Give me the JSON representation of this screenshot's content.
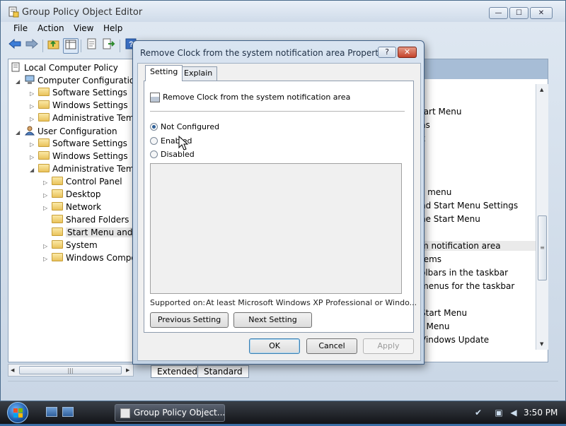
{
  "window": {
    "title": "Group Policy Object Editor",
    "controls": {
      "minimize": "—",
      "maximize": "☐",
      "close": "✕"
    }
  },
  "menu": [
    "File",
    "Action",
    "View",
    "Help"
  ],
  "toolbar": {
    "back": "back-arrow-icon",
    "forward": "forward-arrow-icon",
    "up": "up-folder-icon",
    "show_hide_tree": "show-hide-tree-icon",
    "properties": "properties-icon",
    "export": "export-list-icon",
    "help": "help-icon"
  },
  "tree": [
    {
      "label": "Local Computer Policy",
      "indent": 0,
      "arrow": "",
      "icon": "policy"
    },
    {
      "label": "Computer Configuration",
      "indent": 1,
      "arrow": "◢",
      "icon": "computer"
    },
    {
      "label": "Software Settings",
      "indent": 2,
      "arrow": "▷",
      "icon": "folder"
    },
    {
      "label": "Windows Settings",
      "indent": 2,
      "arrow": "▷",
      "icon": "folder"
    },
    {
      "label": "Administrative Temp",
      "indent": 2,
      "arrow": "▷",
      "icon": "folder"
    },
    {
      "label": "User Configuration",
      "indent": 1,
      "arrow": "◢",
      "icon": "user"
    },
    {
      "label": "Software Settings",
      "indent": 2,
      "arrow": "▷",
      "icon": "folder"
    },
    {
      "label": "Windows Settings",
      "indent": 2,
      "arrow": "▷",
      "icon": "folder"
    },
    {
      "label": "Administrative Temp",
      "indent": 2,
      "arrow": "◢",
      "icon": "folder"
    },
    {
      "label": "Control Panel",
      "indent": 3,
      "arrow": "▷",
      "icon": "folder"
    },
    {
      "label": "Desktop",
      "indent": 3,
      "arrow": "▷",
      "icon": "folder"
    },
    {
      "label": "Network",
      "indent": 3,
      "arrow": "▷",
      "icon": "folder"
    },
    {
      "label": "Shared Folders",
      "indent": 3,
      "arrow": "",
      "icon": "folder"
    },
    {
      "label": "Start Menu and T",
      "indent": 3,
      "arrow": "",
      "icon": "folder",
      "selected": true
    },
    {
      "label": "System",
      "indent": 3,
      "arrow": "▷",
      "icon": "folder"
    },
    {
      "label": "Windows Compo",
      "indent": 3,
      "arrow": "▷",
      "icon": "folder"
    }
  ],
  "right_items": [
    {
      "text": "tart Menu"
    },
    {
      "text": "ns"
    },
    {
      "text": "k"
    },
    {
      "text": ""
    },
    {
      "text": ""
    },
    {
      "text": "s menu"
    },
    {
      "text": "nd Start Menu Settings"
    },
    {
      "text": "ne Start Menu"
    },
    {
      "text": ""
    },
    {
      "text": "m notification area",
      "highlight": true
    },
    {
      "text": "tems"
    },
    {
      "text": "olbars in the taskbar"
    },
    {
      "text": "menus for the taskbar"
    },
    {
      "text": ""
    },
    {
      "text": "Start Menu"
    },
    {
      "text": "t Menu"
    },
    {
      "text": "Vindows Update"
    }
  ],
  "bottom_tabs": [
    "Extended",
    "Standard"
  ],
  "dialog": {
    "title": "Remove Clock from the system notification area Properties",
    "help_button": "?",
    "close_button": "✕",
    "tabs": [
      "Setting",
      "Explain"
    ],
    "policy_name": "Remove Clock from the system notification area",
    "options": [
      {
        "label": "Not Configured",
        "checked": true
      },
      {
        "label": "Enabled",
        "checked": false
      },
      {
        "label": "Disabled",
        "checked": false
      }
    ],
    "supported_label": "Supported on:",
    "supported_value": "At least Microsoft Windows XP Professional or Windo...",
    "previous_setting": "Previous Setting",
    "next_setting": "Next Setting",
    "ok": "OK",
    "cancel": "Cancel",
    "apply": "Apply"
  },
  "taskbar": {
    "task_label": "Group Policy Object...",
    "clock": "3:50 PM"
  }
}
